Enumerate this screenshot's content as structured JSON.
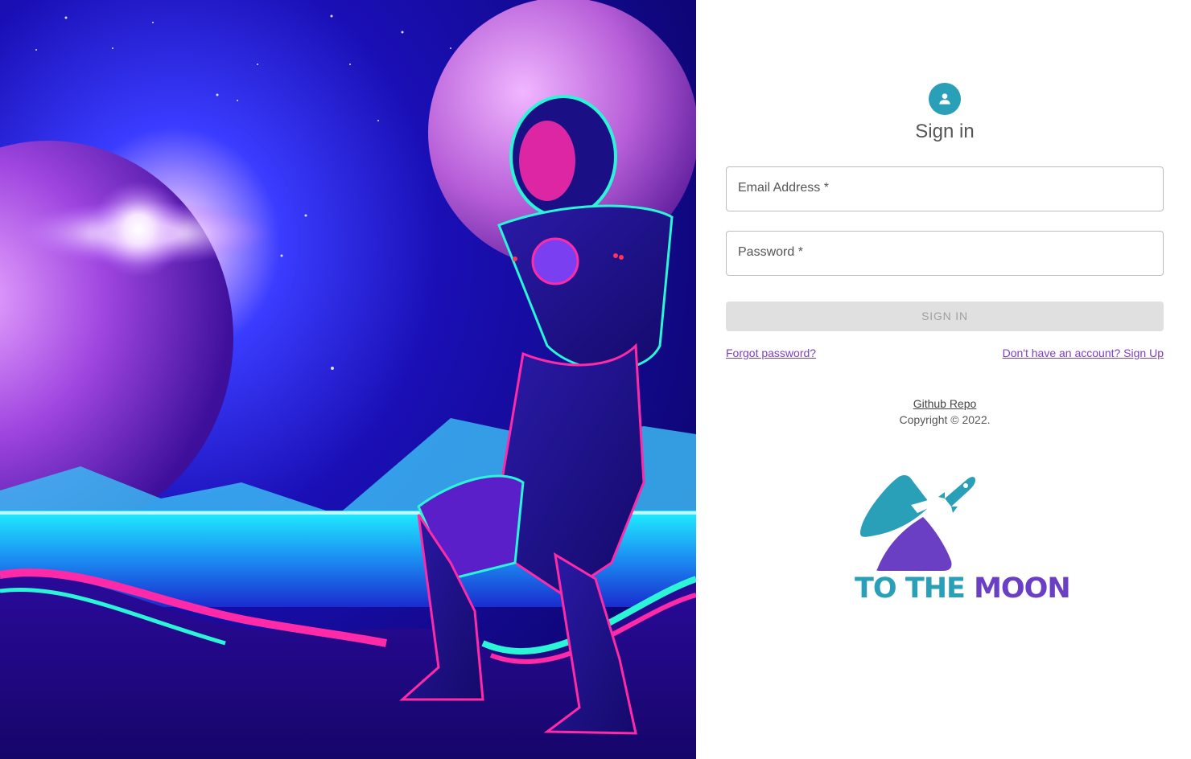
{
  "form": {
    "title": "Sign in",
    "email_label": "Email Address *",
    "password_label": "Password *",
    "submit_label": "SIGN IN",
    "forgot_link": "Forgot password?",
    "signup_link": "Don't have an account? Sign Up"
  },
  "footer": {
    "repo_link": "Github Repo",
    "copyright": "Copyright © 2022."
  },
  "logo": {
    "text_part1": "TO THE ",
    "text_part2": "MOON"
  },
  "colors": {
    "accent": "#2a9fb8",
    "link": "#7b3fc4",
    "button_disabled_bg": "#e0e0e0",
    "logo_teal": "#2a9fb8",
    "logo_purple": "#6b3fc4"
  },
  "icons": {
    "avatar": "person-icon",
    "rocket": "rocket-icon"
  }
}
